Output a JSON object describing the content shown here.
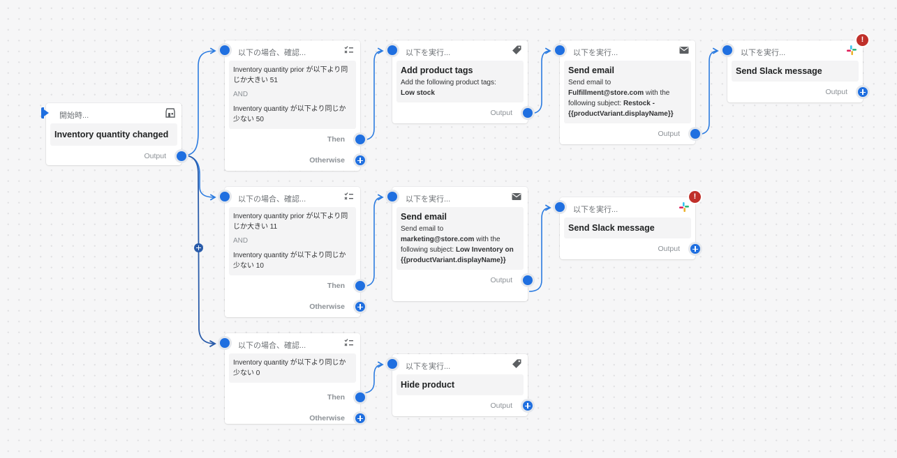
{
  "colors": {
    "accent": "#1f6fe0",
    "wire": "#2b7be0",
    "wire_dark": "#2a5caa",
    "error": "#c0302a",
    "canvas": "#f6f6f7"
  },
  "trigger": {
    "kind": "開始時...",
    "icon": "store-icon",
    "title": "Inventory quantity changed",
    "output_label": "Output"
  },
  "conditions": [
    {
      "kind": "以下の場合、確認...",
      "icon": "checklist-icon",
      "rules": [
        "Inventory quantity prior が以下より同じか大きい 51",
        "Inventory quantity が以下より同じか少ない 50"
      ],
      "joiner": "AND",
      "then_label": "Then",
      "otherwise_label": "Otherwise"
    },
    {
      "kind": "以下の場合、確認...",
      "icon": "checklist-icon",
      "rules": [
        "Inventory quantity prior が以下より同じか大きい 11",
        "Inventory quantity が以下より同じか少ない 10"
      ],
      "joiner": "AND",
      "then_label": "Then",
      "otherwise_label": "Otherwise"
    },
    {
      "kind": "以下の場合、確認...",
      "icon": "checklist-icon",
      "rules": [
        "Inventory quantity が以下より同じか少ない 0"
      ],
      "then_label": "Then",
      "otherwise_label": "Otherwise"
    }
  ],
  "actions": {
    "add_tags": {
      "kind": "以下を実行...",
      "icon": "tag-icon",
      "title": "Add product tags",
      "desc_prefix": "Add the following product tags:",
      "tags": "Low stock",
      "output_label": "Output"
    },
    "email_restock": {
      "kind": "以下を実行...",
      "icon": "mail-icon",
      "title": "Send email",
      "desc_1": "Send email to",
      "to": "Fulfillment@store.com",
      "desc_2": " with the following subject: ",
      "subject": "Restock - {{productVariant.displayName}}",
      "output_label": "Output"
    },
    "slack_1": {
      "kind": "以下を実行...",
      "icon": "slack-icon",
      "title": "Send Slack message",
      "error_badge": "!",
      "output_label": "Output"
    },
    "email_low": {
      "kind": "以下を実行...",
      "icon": "mail-icon",
      "title": "Send email",
      "desc_1": "Send email to",
      "to": "marketing@store.com",
      "desc_2": " with the following subject: ",
      "subject": "Low Inventory on {{productVariant.displayName}}",
      "output_label": "Output"
    },
    "slack_2": {
      "kind": "以下を実行...",
      "icon": "slack-icon",
      "title": "Send Slack message",
      "error_badge": "!",
      "output_label": "Output"
    },
    "hide_product": {
      "kind": "以下を実行...",
      "icon": "tag-icon",
      "title": "Hide product",
      "output_label": "Output"
    }
  }
}
